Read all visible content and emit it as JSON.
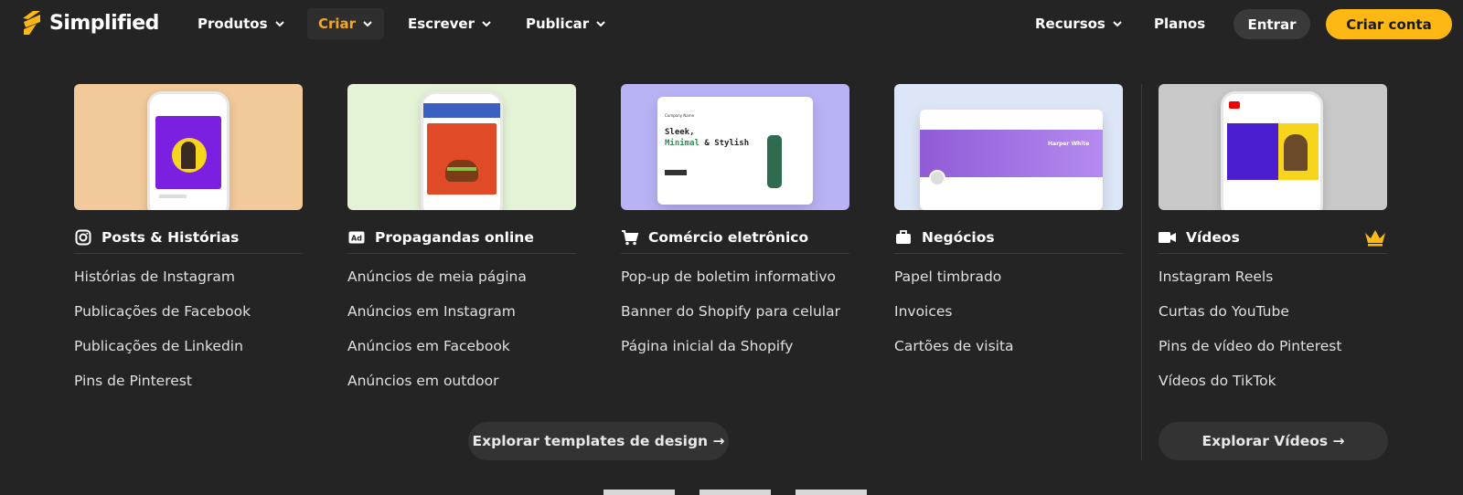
{
  "brand": {
    "name": "Simplified",
    "accent": "#fdb813"
  },
  "nav": {
    "items": [
      {
        "label": "Produtos"
      },
      {
        "label": "Criar"
      },
      {
        "label": "Escrever"
      },
      {
        "label": "Publicar"
      },
      {
        "label": "Recursos"
      },
      {
        "label": "Planos"
      }
    ],
    "login_label": "Entrar",
    "signup_label": "Criar conta"
  },
  "columns": [
    {
      "title": "Posts & Histórias",
      "icon": "instagram-icon",
      "thumb_bg": "#f2c99a",
      "links": [
        "Histórias de Instagram",
        "Publicações de Facebook",
        "Publicações de Linkedin",
        "Pins de Pinterest"
      ]
    },
    {
      "title": "Propagandas online",
      "icon": "ad-icon",
      "thumb_bg": "#e4f2d6",
      "links": [
        "Anúncios de meia página",
        "Anúncios em Instagram",
        "Anúncios em Facebook",
        "Anúncios em outdoor"
      ]
    },
    {
      "title": "Comércio eletrônico",
      "icon": "cart-icon",
      "thumb_bg": "#b8b3f5",
      "thumb_text": {
        "company": "Company Name",
        "headline_1": "Sleek,",
        "headline_2": "Minimal",
        "headline_3": "& Stylish"
      },
      "links": [
        "Pop-up de boletim informativo",
        "Banner do Shopify para celular",
        "Página inicial da Shopify"
      ]
    },
    {
      "title": "Negócios",
      "icon": "briefcase-icon",
      "thumb_bg": "#dde6f7",
      "thumb_text": {
        "name": "Harper White"
      },
      "links": [
        "Papel timbrado",
        "Invoices",
        "Cartões de visita"
      ]
    },
    {
      "title": "Vídeos",
      "icon": "video-icon",
      "thumb_bg": "#c8c8c8",
      "premium_icon": "crown-icon",
      "links": [
        "Instagram Reels",
        "Curtas do YouTube",
        "Pins de vídeo do Pinterest",
        "Vídeos do TikTok"
      ]
    }
  ],
  "explore_design_label": "Explorar templates de design →",
  "explore_videos_label": "Explorar Vídeos →"
}
